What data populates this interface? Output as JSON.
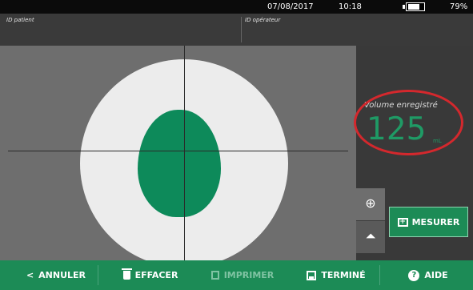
{
  "status": {
    "date": "07/08/2017",
    "time": "10:18",
    "battery_percent": "79%",
    "battery_level": 0.79
  },
  "ids": {
    "patient_label": "ID patient",
    "operator_label": "ID opérateur"
  },
  "result": {
    "label": "Volume enregistré",
    "value": "125",
    "unit": "mL"
  },
  "side_tabs": [
    {
      "name": "crosshair-view-tab",
      "icon": "crosshair-icon",
      "glyph": "⊕"
    },
    {
      "name": "scan-view-tab",
      "icon": "scan-cone-icon",
      "glyph": "⏶"
    }
  ],
  "measure_button": {
    "label": "MESURER",
    "icon": "measure-icon",
    "icon_glyph": "+"
  },
  "bottom_bar": {
    "cancel": "ANNULER",
    "clear": "EFFACER",
    "print": "IMPRIMER",
    "done": "TERMINÉ",
    "help": "AIDE",
    "help_glyph": "?",
    "back_glyph": "<"
  },
  "colors": {
    "accent": "#1c8b56",
    "bladder": "#0d8a5a",
    "highlight_ring": "#d4282d"
  }
}
